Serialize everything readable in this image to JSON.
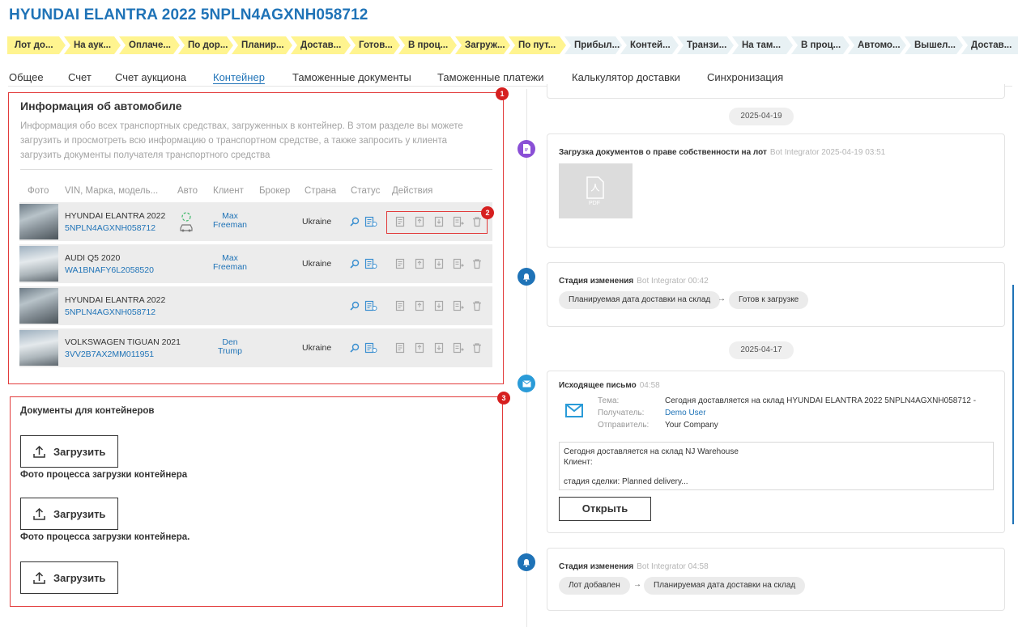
{
  "header": {
    "title": "HYUNDAI ELANTRA 2022 5NPLN4AGXNH058712"
  },
  "stages": [
    {
      "label": "Лот до...",
      "color": "yellow"
    },
    {
      "label": "На аук...",
      "color": "yellow"
    },
    {
      "label": "Оплаче...",
      "color": "yellow"
    },
    {
      "label": "По дор...",
      "color": "yellow"
    },
    {
      "label": "Планир...",
      "color": "yellow"
    },
    {
      "label": "Достав...",
      "color": "yellow"
    },
    {
      "label": "Готов...",
      "color": "yellow"
    },
    {
      "label": "В проц...",
      "color": "yellow"
    },
    {
      "label": "Загруж...",
      "color": "yellow"
    },
    {
      "label": "По пут...",
      "color": "yellow"
    },
    {
      "label": "Прибыл...",
      "color": "gray"
    },
    {
      "label": "Контей...",
      "color": "gray"
    },
    {
      "label": "Транзи...",
      "color": "gray"
    },
    {
      "label": "На там...",
      "color": "gray"
    },
    {
      "label": "В проц...",
      "color": "gray"
    },
    {
      "label": "Автомо...",
      "color": "gray"
    },
    {
      "label": "Вышел...",
      "color": "gray"
    },
    {
      "label": "Достав...",
      "color": "gray"
    }
  ],
  "tabs": [
    {
      "label": "Общее",
      "active": false
    },
    {
      "label": "Счет",
      "active": false
    },
    {
      "label": "Счет аукциона",
      "active": false
    },
    {
      "label": "Контейнер",
      "active": true
    },
    {
      "label": "Таможенные документы",
      "active": false
    },
    {
      "label": "Таможенные платежи",
      "active": false
    },
    {
      "label": "Калькулятор доставки",
      "active": false
    },
    {
      "label": "Синхронизация",
      "active": false
    }
  ],
  "badges": {
    "b1": "1",
    "b2": "2",
    "b3": "3"
  },
  "vehicles": {
    "title": "Информация об автомобиле",
    "description": "Информация обо всех транспортных средствах, загруженных в контейнер. В этом разделе вы можете загрузить и просмотреть всю информацию о транспортном средстве, а также запросить у клиента загрузить документы получателя транспортного средства",
    "columns": [
      "Фото",
      "VIN, Марка, модель...",
      "Авто",
      "Клиент",
      "Брокер",
      "Страна",
      "Статус",
      "Действия"
    ],
    "rows": [
      {
        "name": "HYUNDAI ELANTRA 2022",
        "vin": "5NPLN4AGXNH058712",
        "client_first": "Max",
        "client_last": "Freeman",
        "country": "Ukraine"
      },
      {
        "name": "AUDI Q5 2020",
        "vin": "WA1BNAFY6L2058520",
        "client_first": "Max",
        "client_last": "Freeman",
        "country": "Ukraine"
      },
      {
        "name": "HYUNDAI ELANTRA 2022",
        "vin": "5NPLN4AGXNH058712",
        "client_first": "",
        "client_last": "",
        "country": ""
      },
      {
        "name": "VOLKSWAGEN TIGUAN 2021",
        "vin": "3VV2B7AX2MM011951",
        "client_first": "Den",
        "client_last": "Trump",
        "country": "Ukraine"
      }
    ]
  },
  "documents": {
    "title": "Документы для контейнеров",
    "upload_label": "Загрузить",
    "caption1": "Фото процесса загрузки контейнера",
    "caption2": "Фото процесса загрузки контейнера."
  },
  "feed": {
    "date1": "2025-04-19",
    "date2": "2025-04-17",
    "doc_upload": {
      "title": "Загрузка документов о праве собственности на лот",
      "meta": "Bot Integrator 2025-04-19 03:51",
      "file_label": "PDF"
    },
    "stage1": {
      "title": "Стадия изменения",
      "meta": "Bot Integrator 00:42",
      "from": "Планируемая дата доставки на склад",
      "to": "Готов к загрузке"
    },
    "email": {
      "title": "Исходящее письмо",
      "meta": "04:58",
      "subject_label": "Тема:",
      "subject": "Сегодня доставляется на склад HYUNDAI ELANTRA 2022 5NPLN4AGXNH058712 -",
      "recipient_label": "Получатель:",
      "recipient": "Demo User",
      "sender_label": "Отправитель:",
      "sender": "Your Company",
      "body1": "Сегодня доставляется на склад NJ Warehouse",
      "body2": "Клиент:",
      "body3": "стадия сделки: Planned delivery...",
      "open_label": "Открыть"
    },
    "stage2": {
      "title": "Стадия изменения",
      "meta": "Bot Integrator 04:58",
      "from": "Лот добавлен",
      "to": "Планируемая дата доставки на склад"
    },
    "arrow": "→"
  },
  "colors": {
    "accent": "#1f73b7",
    "stage_done": "#fff48f",
    "stage_todo": "#e8f1f4",
    "highlight": "#e23b3b"
  }
}
